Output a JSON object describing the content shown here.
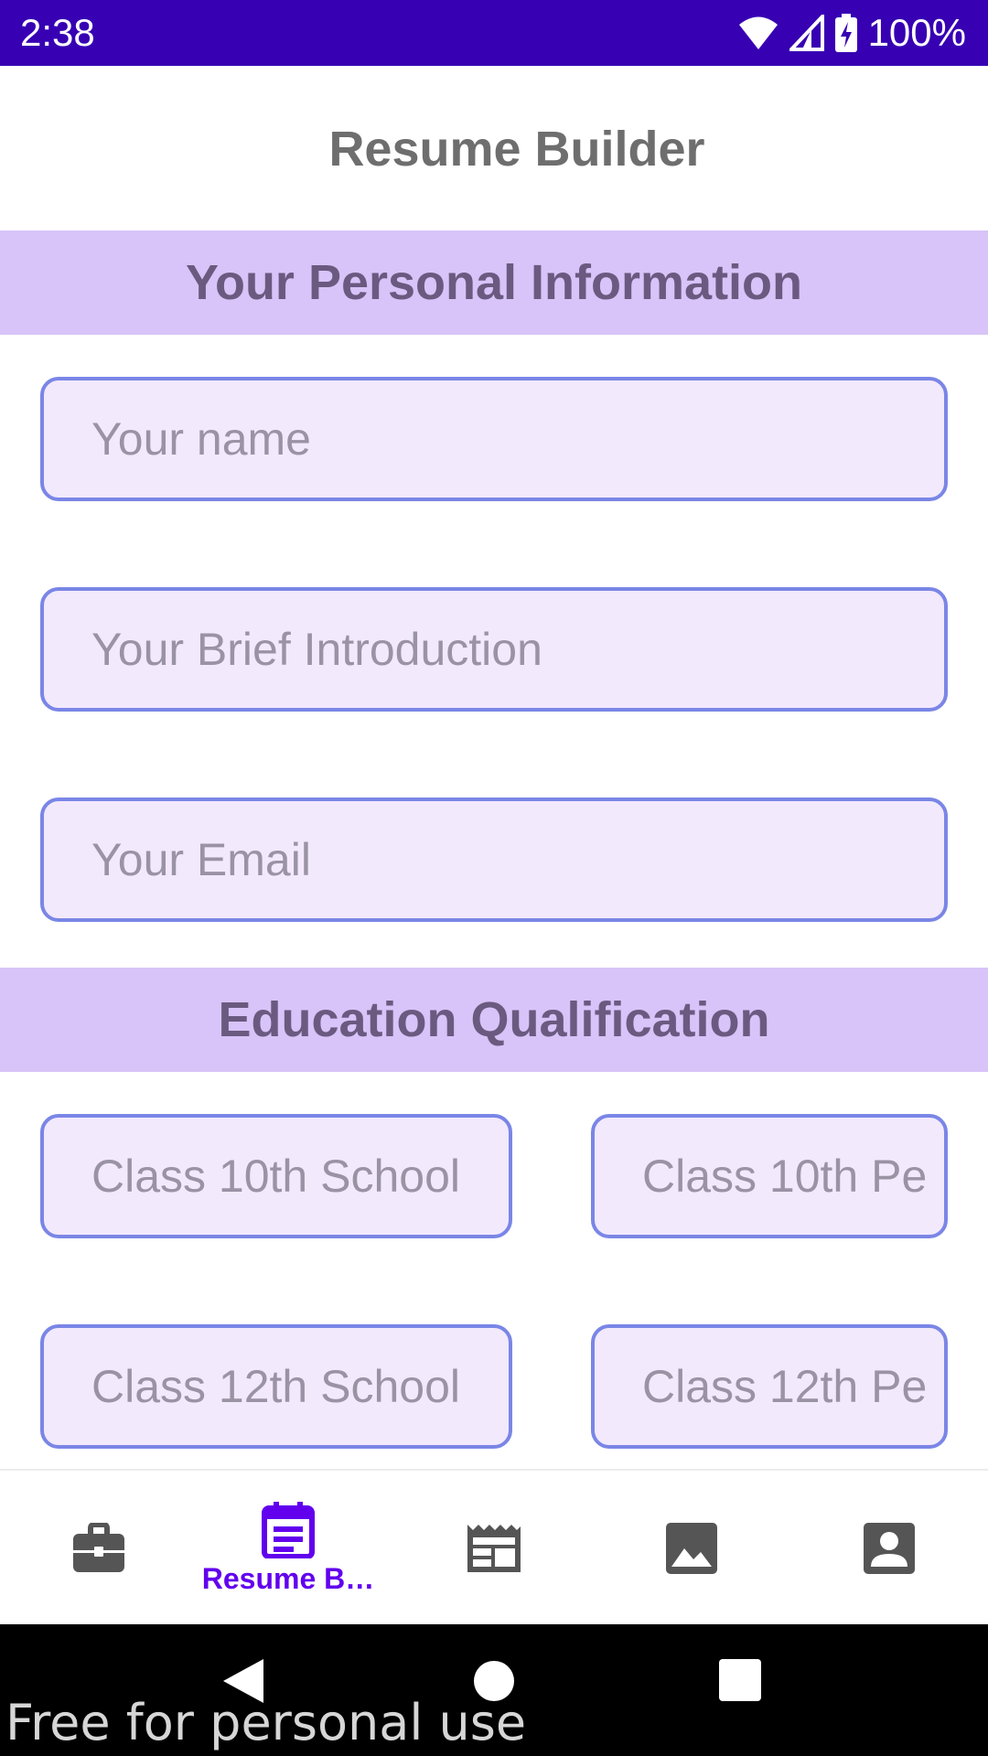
{
  "status_bar": {
    "time": "2:38",
    "battery": "100%"
  },
  "app": {
    "title": "Resume Builder"
  },
  "personal": {
    "heading": "Your Personal Information",
    "name_placeholder": "Your name",
    "intro_placeholder": "Your Brief Introduction",
    "email_placeholder": "Your Email"
  },
  "education": {
    "heading": "Education Qualification",
    "class10_school_placeholder": "Class 10th School",
    "class10_percent_placeholder": "Class 10th Pe",
    "class12_school_placeholder": "Class 12th School",
    "class12_percent_placeholder": "Class 12th Pe"
  },
  "bottom_nav": {
    "active_label": "Resume B…",
    "items": [
      {
        "icon": "briefcase-icon"
      },
      {
        "icon": "calendar-note-icon",
        "active": true
      },
      {
        "icon": "newspaper-icon"
      },
      {
        "icon": "image-icon"
      },
      {
        "icon": "account-box-icon"
      }
    ]
  },
  "watermark": "Free for personal use",
  "colors": {
    "status_bar": "#3700b3",
    "section_bg": "#d8c4f8",
    "field_border": "#7a86e6",
    "field_bg": "#f3e9fd",
    "accent": "#6200ee"
  }
}
